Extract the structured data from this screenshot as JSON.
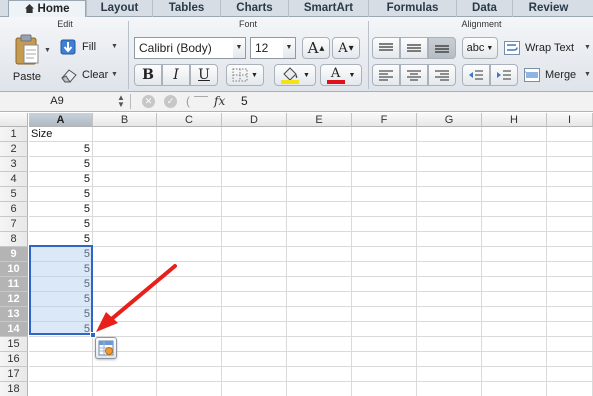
{
  "ribbon_tabs": [
    "Home",
    "Layout",
    "Tables",
    "Charts",
    "SmartArt",
    "Formulas",
    "Data",
    "Review"
  ],
  "groups": {
    "edit": {
      "title": "Edit",
      "paste_label": "Paste",
      "fill_label": "Fill",
      "clear_label": "Clear"
    },
    "font": {
      "title": "Font",
      "font_name": "Calibri (Body)",
      "font_size": "12",
      "grow_label": "A",
      "shrink_label": "A",
      "bold_label": "B",
      "italic_label": "I",
      "underline_label": "U",
      "font_color_label": "A",
      "font_color": "#e0101a",
      "highlight_color": "#f3e216"
    },
    "alignment": {
      "title": "Alignment",
      "orientation_label": "abc",
      "wrap_text_label": "Wrap Text",
      "merge_label": "Merge"
    }
  },
  "formula_bar": {
    "name_box": "A9",
    "fx_label": "fx",
    "value": "5"
  },
  "columns": [
    "A",
    "B",
    "C",
    "D",
    "E",
    "F",
    "G",
    "H",
    "I"
  ],
  "rows": [
    "1",
    "2",
    "3",
    "4",
    "5",
    "6",
    "7",
    "8",
    "9",
    "10",
    "11",
    "12",
    "13",
    "14",
    "15",
    "16",
    "17",
    "18"
  ],
  "column_a": [
    "Size",
    "5",
    "5",
    "5",
    "5",
    "5",
    "5",
    "5",
    "5",
    "5",
    "5",
    "5",
    "5",
    "5"
  ],
  "selection_range": "A9:A14",
  "annotation": {
    "arrow_color": "#e8201c"
  },
  "colors": {
    "selection_border": "#2f65c7",
    "selection_fill": "#afcdf0"
  }
}
